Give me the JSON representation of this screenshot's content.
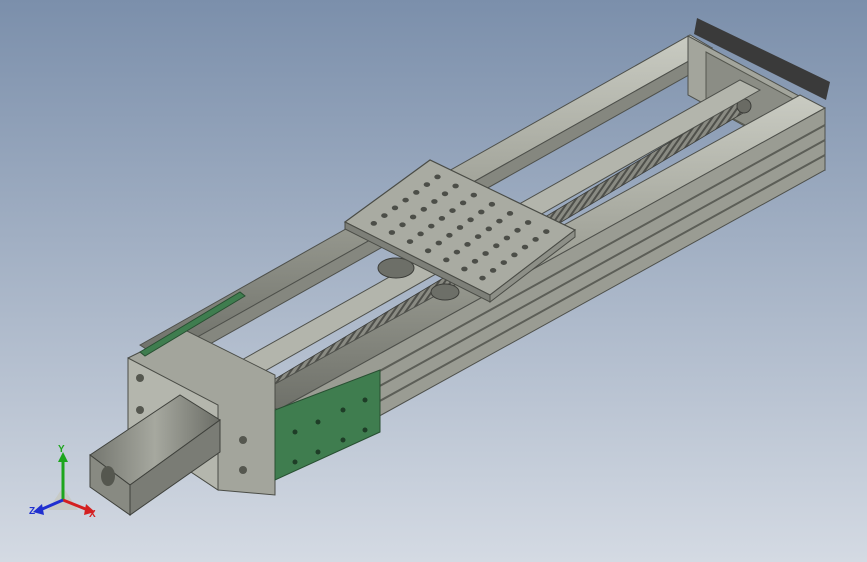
{
  "viewport": {
    "background_top": "#7b8fab",
    "background_bottom": "#d4dae3"
  },
  "model": {
    "frame_color": "#9ea096",
    "frame_dark": "#6b6d66",
    "frame_light": "#c6c8bf",
    "plate_color": "#a7a89f",
    "green_plate": "#3f7d4f",
    "motor_color": "#8f918a",
    "screw_color": "#7f8077"
  },
  "triad": {
    "x_label": "X",
    "y_label": "Y",
    "z_label": "Z",
    "x_color": "#d42020",
    "y_color": "#1da51d",
    "z_color": "#2030d0"
  }
}
